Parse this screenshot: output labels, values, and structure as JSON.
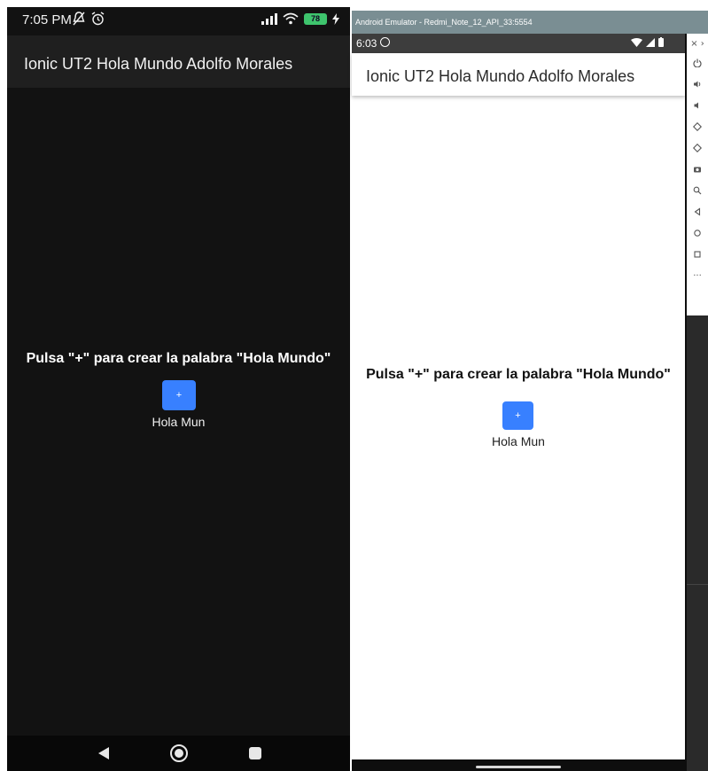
{
  "left_phone": {
    "status_bar": {
      "time": "7:05 PM",
      "battery": "78"
    },
    "toolbar": {
      "title": "Ionic UT2 Hola Mundo Adolfo Morales"
    },
    "content": {
      "message": "Pulsa \"+\" para crear la palabra \"Hola Mundo\"",
      "add_button_label": "+",
      "output_text": "Hola Mun"
    }
  },
  "emulator": {
    "window_title": "Android Emulator - Redmi_Note_12_API_33:5554",
    "status_bar": {
      "time": "6:03"
    },
    "toolbar": {
      "title": "Ionic UT2 Hola Mundo Adolfo Morales"
    },
    "content": {
      "message": "Pulsa \"+\" para crear la palabra \"Hola Mundo\"",
      "add_button_label": "+",
      "output_text": "Hola Mun"
    },
    "side_toolbar": {
      "close_glyph": "× ›",
      "more_glyph": "···"
    }
  },
  "colors": {
    "primary": "#3880ff",
    "dark_background": "#121212",
    "dark_toolbar": "#1f1f1f",
    "emulator_titlebar": "#7a8e93"
  }
}
